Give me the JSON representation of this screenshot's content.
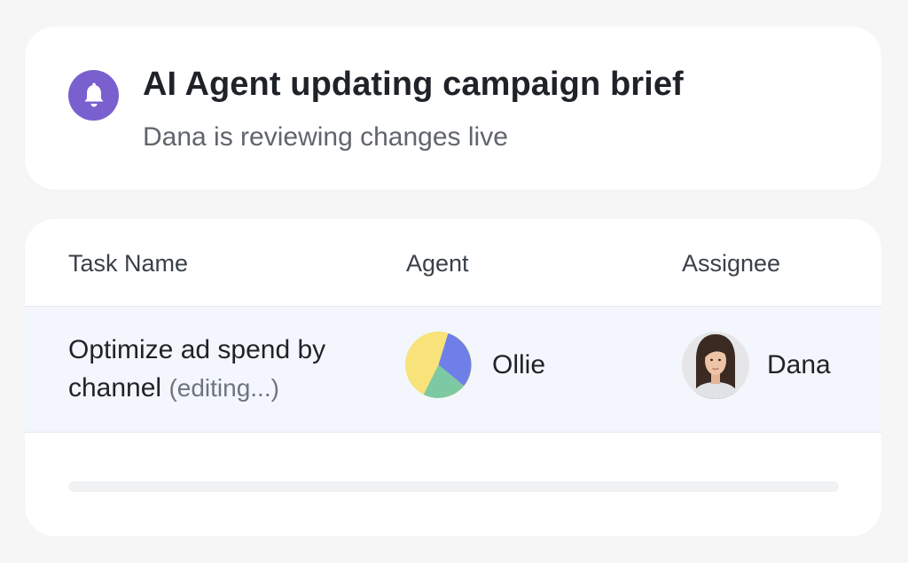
{
  "notification": {
    "icon": "bell-icon",
    "icon_bg": "#7a5fcf",
    "title": "AI Agent updating campaign brief",
    "subtitle": "Dana is reviewing changes live"
  },
  "table": {
    "columns": [
      "Task Name",
      "Agent",
      "Assignee"
    ],
    "rows": [
      {
        "task_line1": "Optimize ad spend by",
        "task_line2": "channel",
        "task_status": "(editing...)",
        "agent": {
          "name": "Ollie",
          "avatar": "pie-chart-avatar",
          "colors": [
            "#f7e37a",
            "#6f7fe8",
            "#7cc9a3"
          ]
        },
        "assignee": {
          "name": "Dana",
          "avatar": "user-photo-avatar"
        }
      }
    ],
    "row_highlight": "#f3f7fd"
  }
}
